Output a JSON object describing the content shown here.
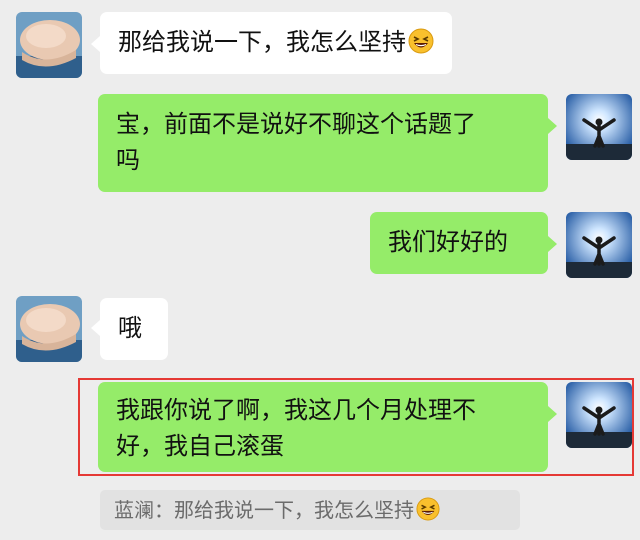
{
  "messages": [
    {
      "side": "left",
      "text": "那给我说一下，我怎么坚持",
      "emoji": "grinning-squinting-face-emoji"
    },
    {
      "side": "right",
      "line1": "宝，前面不是说好不聊这个话题了",
      "line2": "吗"
    },
    {
      "side": "right",
      "text": "我们好好的"
    },
    {
      "side": "left",
      "text": "哦"
    },
    {
      "side": "right",
      "line1": "我跟你说了啊，我这几个月处理不",
      "line2": "好，我自己滚蛋"
    }
  ],
  "quote": {
    "text": "蓝澜：那给我说一下，我怎么坚持",
    "emoji": "grinning-squinting-face-emoji"
  },
  "colors": {
    "background": "#ededed",
    "incoming_bubble": "#ffffff",
    "outgoing_bubble": "#95ec69",
    "highlight_border": "#e53935"
  }
}
